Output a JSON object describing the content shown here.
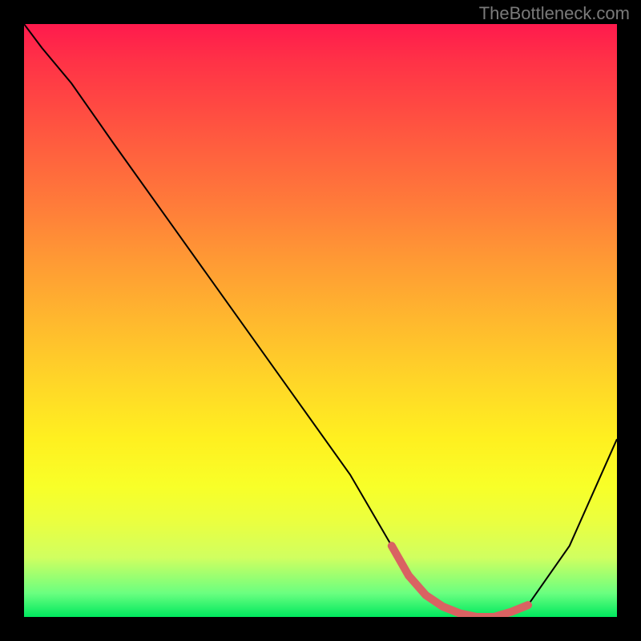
{
  "watermark": "TheBottleneck.com",
  "chart_data": {
    "type": "line",
    "title": "",
    "xlabel": "",
    "ylabel": "",
    "xlim": [
      0,
      100
    ],
    "ylim": [
      0,
      100
    ],
    "grid": false,
    "legend_position": "none",
    "series": [
      {
        "name": "bottleneck-curve",
        "x": [
          0,
          3,
          8,
          15,
          25,
          35,
          45,
          55,
          62,
          66,
          70,
          75,
          80,
          85,
          92,
          100
        ],
        "y": [
          100,
          96,
          90,
          80,
          66,
          52,
          38,
          24,
          12,
          5,
          2,
          0,
          0,
          2,
          12,
          30
        ]
      }
    ],
    "annotations": [
      {
        "name": "trough-highlight",
        "x_start": 62,
        "x_end": 85,
        "color": "#d96262"
      }
    ],
    "background_gradient": [
      "#ff1a4d",
      "#ff7a3a",
      "#ffd528",
      "#f8ff28",
      "#00e85e"
    ]
  }
}
